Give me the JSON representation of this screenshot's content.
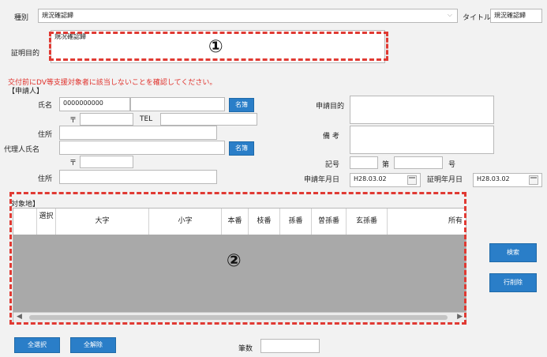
{
  "header": {
    "type_label": "種別",
    "type_value": "規況確認歸",
    "title_label": "タイトル",
    "title_value": "規況確認歸"
  },
  "purpose": {
    "label": "証明目的",
    "value": "規况確認歸",
    "callout": "①"
  },
  "warning": "交付前にDV等支援対象者に該当しないことを確認してください。",
  "applicant": {
    "section_label": "【申請人】",
    "name_label": "氏名",
    "name_value": "0000000000",
    "name_button": "名簿",
    "postal_mark": "〒",
    "tel_label": "TEL",
    "address_label": "住所",
    "agent_label": "代理人氏名",
    "agent_button": "名簿",
    "agent_postal_mark": "〒",
    "agent_address_label": "住所"
  },
  "right_form": {
    "purpose_label": "申請目的",
    "remarks_label": "備 考",
    "record_label": "記号",
    "record_mid": "第",
    "record_suffix": "号",
    "apply_date_label": "申請年月日",
    "apply_date_value": "H28.03.02",
    "cert_date_label": "証明年月日",
    "cert_date_value": "H28.03.02"
  },
  "table": {
    "section_label": "対象地】",
    "columns": [
      "選択",
      "大字",
      "小字",
      "本番",
      "枝番",
      "孫番",
      "曽孫番",
      "玄孫番",
      "所有"
    ],
    "callout": "②"
  },
  "side_buttons": {
    "search": "検索",
    "delete_row": "行削除"
  },
  "footer": {
    "select_all": "全選択",
    "deselect_all": "全解除",
    "count_label": "筆数",
    "count_value": ""
  },
  "colors": {
    "accent": "#2a7ec8",
    "warning": "#e0302a",
    "dash": "#e03a33",
    "grid_body": "#a9a9a9"
  }
}
